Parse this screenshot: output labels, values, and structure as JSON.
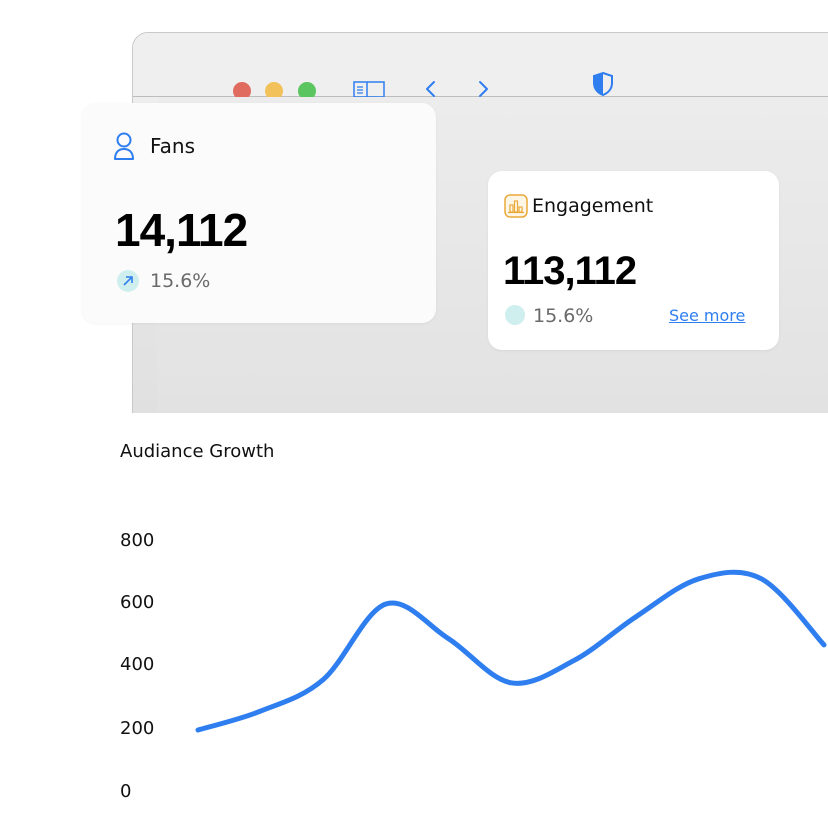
{
  "colors": {
    "accent": "#2f7ef0",
    "line": "#2f7ef0",
    "traffic_red": "#e06c5f",
    "traffic_yellow": "#f3c15a",
    "traffic_green": "#5bc560",
    "engagement_icon": "#e8a93a",
    "trend_badge": "#cfeeee"
  },
  "toolbar": {
    "icons": [
      "sidebar-icon",
      "back-chevron-icon",
      "forward-chevron-icon",
      "shield-icon"
    ]
  },
  "fans": {
    "icon": "user-icon",
    "title": "Fans",
    "value": "14,112",
    "change": "15.6%",
    "change_icon": "arrow-up-right-icon"
  },
  "engagement": {
    "icon": "bar-chart-icon",
    "title": "Engagement",
    "value": "113,112",
    "change": "15.6%",
    "link": "See more"
  },
  "chart": {
    "title": "Audiance Growth",
    "yticks": [
      "800",
      "600",
      "400",
      "200",
      "0"
    ]
  },
  "chart_data": {
    "type": "line",
    "title": "Audiance Growth",
    "xlabel": "",
    "ylabel": "",
    "ylim": [
      0,
      800
    ],
    "grid": false,
    "series": [
      {
        "x": [
          0,
          1,
          2,
          3,
          4,
          5,
          6,
          7,
          8,
          9,
          10
        ],
        "values": [
          200,
          260,
          360,
          600,
          490,
          350,
          420,
          560,
          680,
          680,
          470
        ]
      }
    ]
  }
}
